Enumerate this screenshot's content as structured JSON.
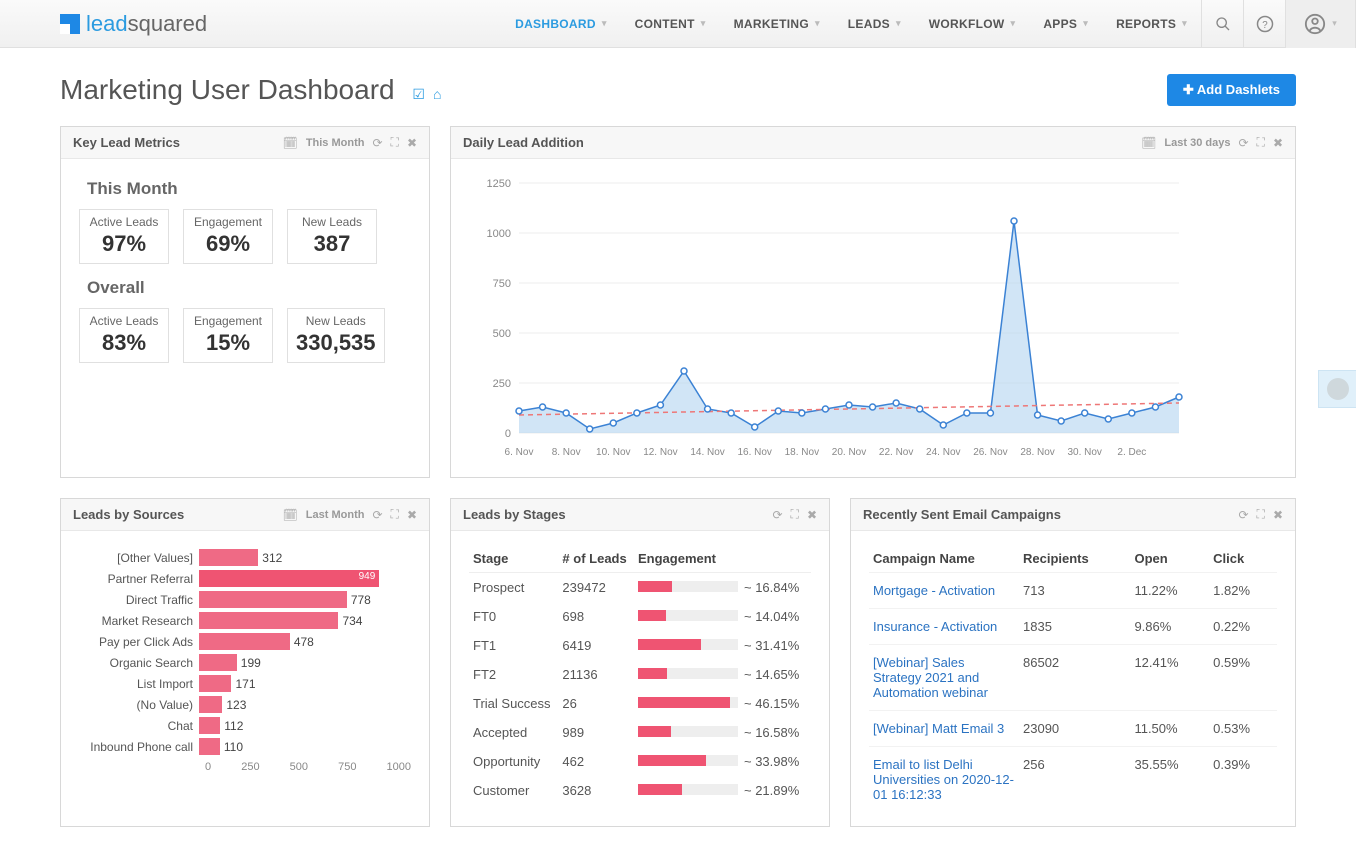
{
  "brand": {
    "part1": "lead",
    "part2": "squared"
  },
  "nav": {
    "items": [
      "DASHBOARD",
      "CONTENT",
      "MARKETING",
      "LEADS",
      "WORKFLOW",
      "APPS",
      "REPORTS"
    ]
  },
  "page": {
    "title": "Marketing User Dashboard",
    "add_btn": "Add Dashlets"
  },
  "cards": {
    "key_metrics": {
      "title": "Key Lead Metrics",
      "range": "This Month",
      "this_month": {
        "heading": "This Month",
        "active_lbl": "Active Leads",
        "active": "97%",
        "eng_lbl": "Engagement",
        "eng": "69%",
        "new_lbl": "New Leads",
        "new": "387"
      },
      "overall": {
        "heading": "Overall",
        "active_lbl": "Active Leads",
        "active": "83%",
        "eng_lbl": "Engagement",
        "eng": "15%",
        "new_lbl": "New Leads",
        "new": "330,535"
      }
    },
    "daily": {
      "title": "Daily Lead Addition",
      "range": "Last 30 days"
    },
    "sources": {
      "title": "Leads by Sources",
      "range": "Last Month"
    },
    "stages": {
      "title": "Leads by Stages",
      "cols": {
        "stage": "Stage",
        "num": "# of Leads",
        "eng": "Engagement"
      }
    },
    "campaigns": {
      "title": "Recently Sent Email Campaigns",
      "cols": {
        "name": "Campaign Name",
        "rec": "Recipients",
        "open": "Open",
        "click": "Click"
      }
    }
  },
  "chart_data": {
    "daily_lead_addition": {
      "type": "area",
      "x_labels": [
        "6. Nov",
        "8. Nov",
        "10. Nov",
        "12. Nov",
        "14. Nov",
        "16. Nov",
        "18. Nov",
        "20. Nov",
        "22. Nov",
        "24. Nov",
        "26. Nov",
        "28. Nov",
        "30. Nov",
        "2. Dec"
      ],
      "ylim": [
        0,
        1250
      ],
      "yticks": [
        0,
        250,
        500,
        750,
        1000,
        1250
      ],
      "series": [
        {
          "name": "leads",
          "values": [
            110,
            130,
            100,
            20,
            50,
            100,
            140,
            310,
            120,
            100,
            30,
            110,
            100,
            120,
            140,
            130,
            150,
            120,
            40,
            100,
            100,
            1060,
            90,
            60,
            100,
            70,
            100,
            130,
            180
          ]
        }
      ],
      "trend": {
        "start": 90,
        "end": 150
      }
    },
    "leads_by_sources": {
      "type": "bar",
      "orientation": "horizontal",
      "categories": [
        "[Other Values]",
        "Partner Referral",
        "Direct Traffic",
        "Market Research",
        "Pay per Click Ads",
        "Organic Search",
        "List Import",
        "(No Value)",
        "Chat",
        "Inbound Phone call"
      ],
      "values": [
        312,
        949,
        778,
        734,
        478,
        199,
        171,
        123,
        112,
        110
      ],
      "xlim": [
        0,
        1000
      ],
      "xticks": [
        0,
        250,
        500,
        750,
        1000
      ]
    },
    "leads_by_stages": {
      "type": "table",
      "rows": [
        {
          "stage": "Prospect",
          "num": "239472",
          "eng": 16.84
        },
        {
          "stage": "FT0",
          "num": "698",
          "eng": 14.04
        },
        {
          "stage": "FT1",
          "num": "6419",
          "eng": 31.41
        },
        {
          "stage": "FT2",
          "num": "21136",
          "eng": 14.65
        },
        {
          "stage": "Trial Success",
          "num": "26",
          "eng": 46.15
        },
        {
          "stage": "Accepted",
          "num": "989",
          "eng": 16.58
        },
        {
          "stage": "Opportunity",
          "num": "462",
          "eng": 33.98
        },
        {
          "stage": "Customer",
          "num": "3628",
          "eng": 21.89
        }
      ]
    },
    "campaigns": {
      "type": "table",
      "rows": [
        {
          "name": "Mortgage - Activation",
          "rec": "713",
          "open": "11.22%",
          "click": "1.82%"
        },
        {
          "name": "Insurance - Activation",
          "rec": "1835",
          "open": "9.86%",
          "click": "0.22%"
        },
        {
          "name": "[Webinar] Sales Strategy 2021 and Automation webinar",
          "rec": "86502",
          "open": "12.41%",
          "click": "0.59%"
        },
        {
          "name": "[Webinar] Matt Email 3",
          "rec": "23090",
          "open": "11.50%",
          "click": "0.53%"
        },
        {
          "name": "Email to list Delhi Universities on 2020-12-01 16:12:33",
          "rec": "256",
          "open": "35.55%",
          "click": "0.39%"
        }
      ]
    }
  }
}
